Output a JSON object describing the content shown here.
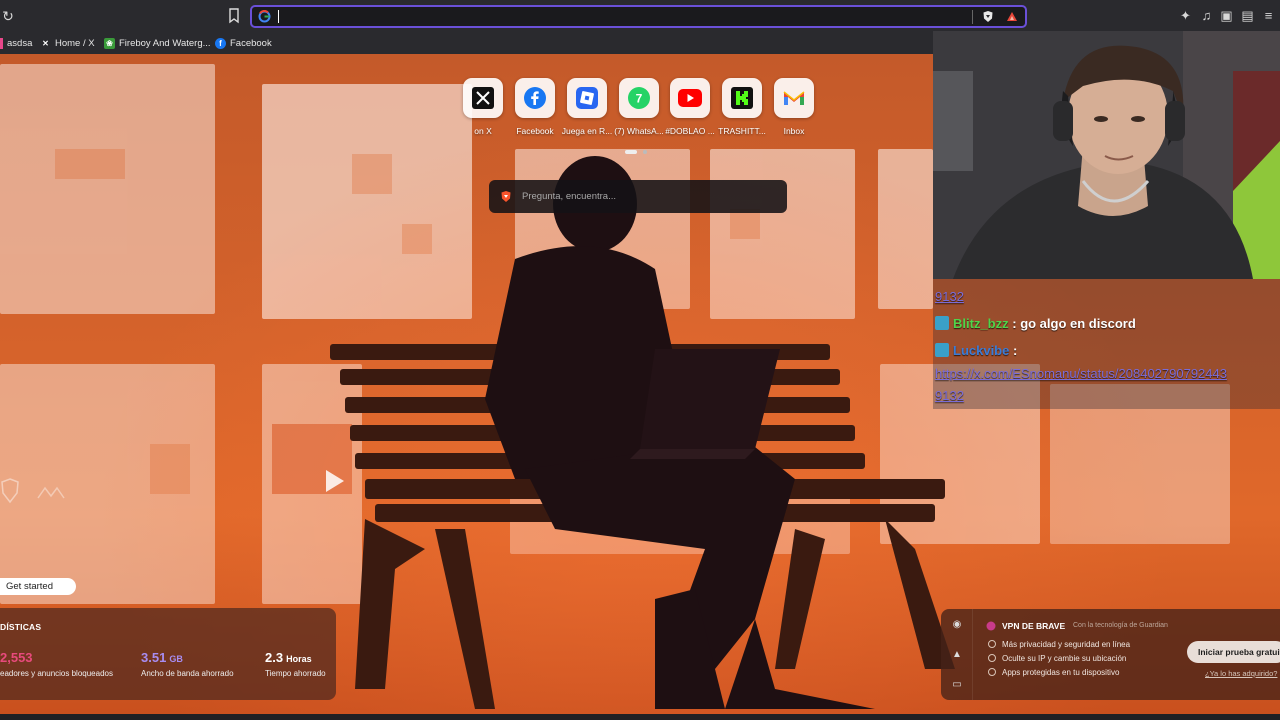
{
  "browser": {
    "url_value": "",
    "url_placeholder": "",
    "bookmarks": [
      {
        "label": "asdsa"
      },
      {
        "label": "Home / X"
      },
      {
        "label": "Fireboy And Waterg..."
      },
      {
        "label": "Facebook"
      }
    ]
  },
  "newtab": {
    "top_sites": [
      {
        "label": "on X",
        "icon": "x-icon"
      },
      {
        "label": "Facebook",
        "icon": "facebook-icon"
      },
      {
        "label": "Juega en R...",
        "icon": "roblox-icon"
      },
      {
        "label": "(7) WhatsA...",
        "icon": "whatsapp-icon"
      },
      {
        "label": "#DOBLAO ...",
        "icon": "youtube-icon"
      },
      {
        "label": "TRASHITT...",
        "icon": "kick-icon"
      },
      {
        "label": "Inbox",
        "icon": "gmail-icon"
      }
    ],
    "search_placeholder": "Pregunta, encuentra...",
    "get_started_label": "Get started",
    "stats": {
      "title": "DÍSTICAS",
      "items": [
        {
          "value": "2,553",
          "unit": "",
          "label": "eadores y anuncios bloqueados",
          "color": "#e84a7c"
        },
        {
          "value": "3.51",
          "unit": "GB",
          "label": "Ancho de banda ahorrado",
          "color": "#a78cf0"
        },
        {
          "value": "2.3",
          "unit": "Horas",
          "label": "Tiempo ahorrado",
          "color": "#ffffff"
        }
      ]
    },
    "vpn": {
      "title": "VPN DE BRAVE",
      "powered_by": "Con la tecnología de  Guardian",
      "features": [
        "Más privacidad y seguridad en línea",
        "Oculte su IP y cambie su ubicación",
        "Apps protegidas en tu dispositivo"
      ],
      "cta_label": "Iniciar prueba gratuita",
      "already_label": "¿Ya lo has adquirido?"
    }
  },
  "chat": {
    "partial_top": "9132",
    "messages": [
      {
        "user": "Blitz_bzz",
        "text": ": go algo en discord",
        "user_color": "#4fd34a"
      },
      {
        "user": "Luckvibe",
        "text": ":",
        "user_color": "#3a7cd8"
      }
    ],
    "link_line1": "https://x.com/ESnomanu/status/208402790792443",
    "link_line2": "9132"
  },
  "colors": {
    "accent_purple": "#6a50d8",
    "scene_orange": "#d4622b"
  }
}
